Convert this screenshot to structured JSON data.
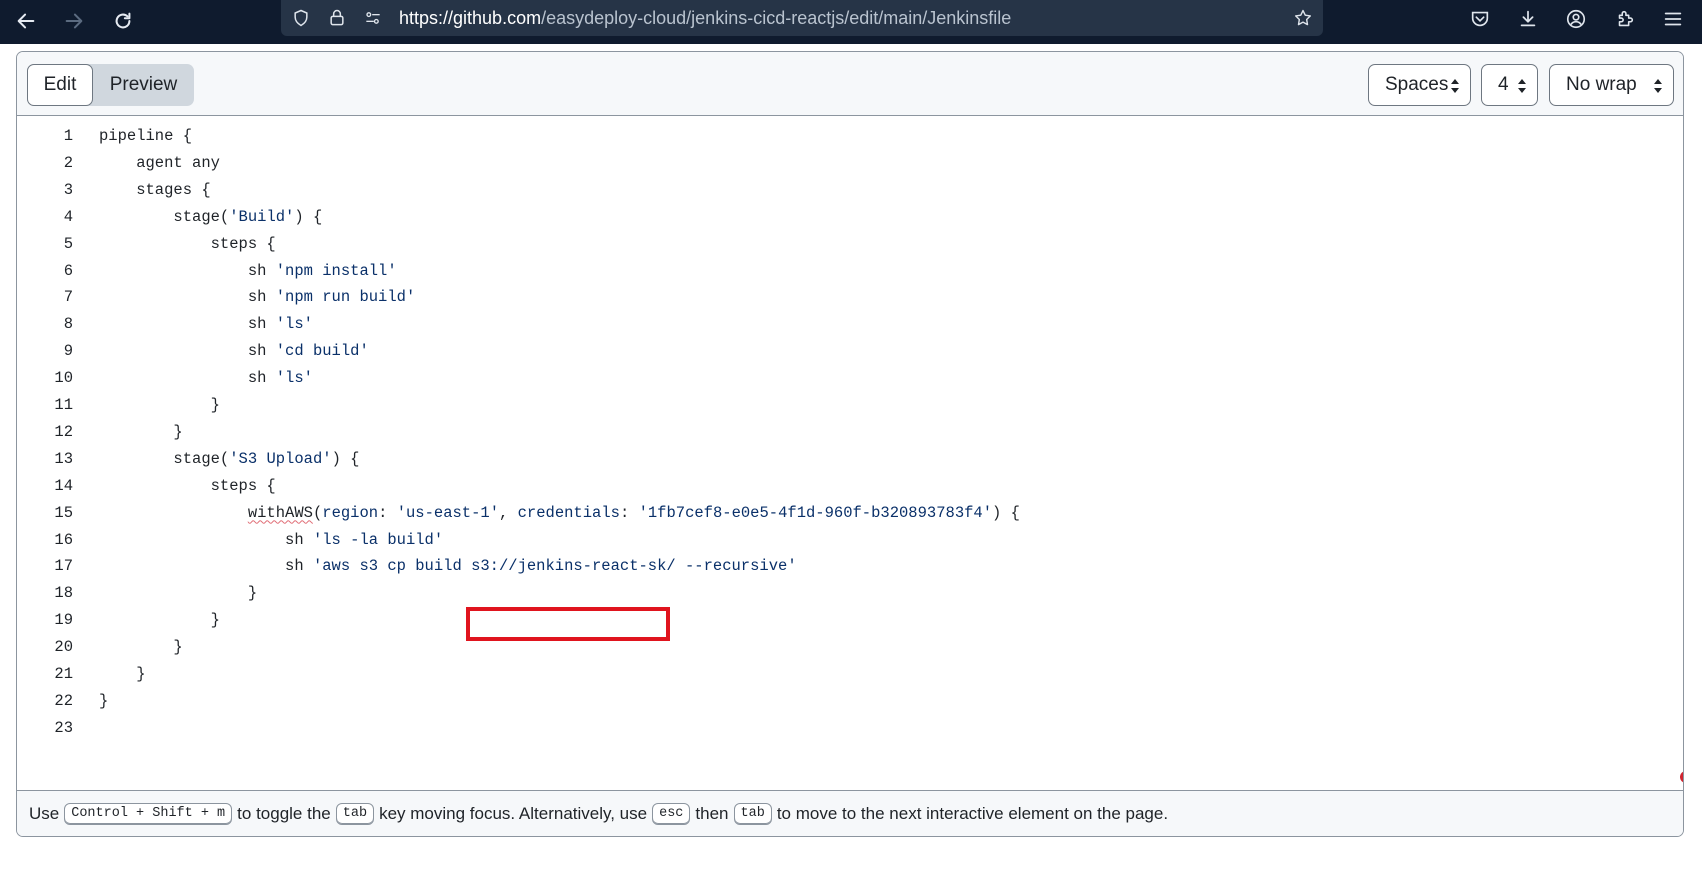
{
  "browser": {
    "url_domain": "https://github.com",
    "url_path": "/easydeploy-cloud/jenkins-cicd-reactjs/edit/main/Jenkinsfile",
    "icons": [
      "back-icon",
      "forward-icon",
      "reload-icon",
      "shield-icon",
      "lock-icon",
      "permissions-icon",
      "star-icon",
      "pocket-icon",
      "download-icon",
      "account-icon",
      "extensions-icon",
      "menu-icon"
    ]
  },
  "editor": {
    "tabs": [
      {
        "label": "Edit",
        "active": true
      },
      {
        "label": "Preview",
        "active": false
      }
    ],
    "indent_mode": "Spaces",
    "indent_size": "4",
    "wrap_mode": "No wrap",
    "highlighted_text": "s3://jenkins-react-sk/",
    "lines": [
      {
        "n": "1",
        "text": "pipeline {"
      },
      {
        "n": "2",
        "text": "    agent any"
      },
      {
        "n": "3",
        "text": "    stages {"
      },
      {
        "n": "4",
        "text": "        stage('Build') {"
      },
      {
        "n": "5",
        "text": "            steps {"
      },
      {
        "n": "6",
        "text": "                sh 'npm install'"
      },
      {
        "n": "7",
        "text": "                sh 'npm run build'"
      },
      {
        "n": "8",
        "text": "                sh 'ls'"
      },
      {
        "n": "9",
        "text": "                sh 'cd build'"
      },
      {
        "n": "10",
        "text": "                sh 'ls'"
      },
      {
        "n": "11",
        "text": "            }"
      },
      {
        "n": "12",
        "text": "        }"
      },
      {
        "n": "13",
        "text": "        stage('S3 Upload') {"
      },
      {
        "n": "14",
        "text": "            steps {"
      },
      {
        "n": "15",
        "text": "                withAWS(region: 'us-east-1', credentials: '1fb7cef8-e0e5-4f1d-960f-b320893783f4') {"
      },
      {
        "n": "16",
        "text": "                    sh 'ls -la build'"
      },
      {
        "n": "17",
        "text": "                    sh 'aws s3 cp build s3://jenkins-react-sk/ --recursive'"
      },
      {
        "n": "18",
        "text": "                }"
      },
      {
        "n": "19",
        "text": "            }"
      },
      {
        "n": "20",
        "text": "        }"
      },
      {
        "n": "21",
        "text": "    }"
      },
      {
        "n": "22",
        "text": "}"
      },
      {
        "n": "23",
        "text": ""
      }
    ]
  },
  "footer": {
    "t1": "Use",
    "k1": "Control + Shift + m",
    "t2": "to toggle the",
    "k2": "tab",
    "t3": "key moving focus. Alternatively, use",
    "k3": "esc",
    "t4": "then",
    "k4": "tab",
    "t5": "to move to the next interactive element on the page."
  },
  "colors": {
    "browser_bar": "#0f1b2e",
    "highlight": "#e0141e",
    "string": "#0a3069"
  }
}
